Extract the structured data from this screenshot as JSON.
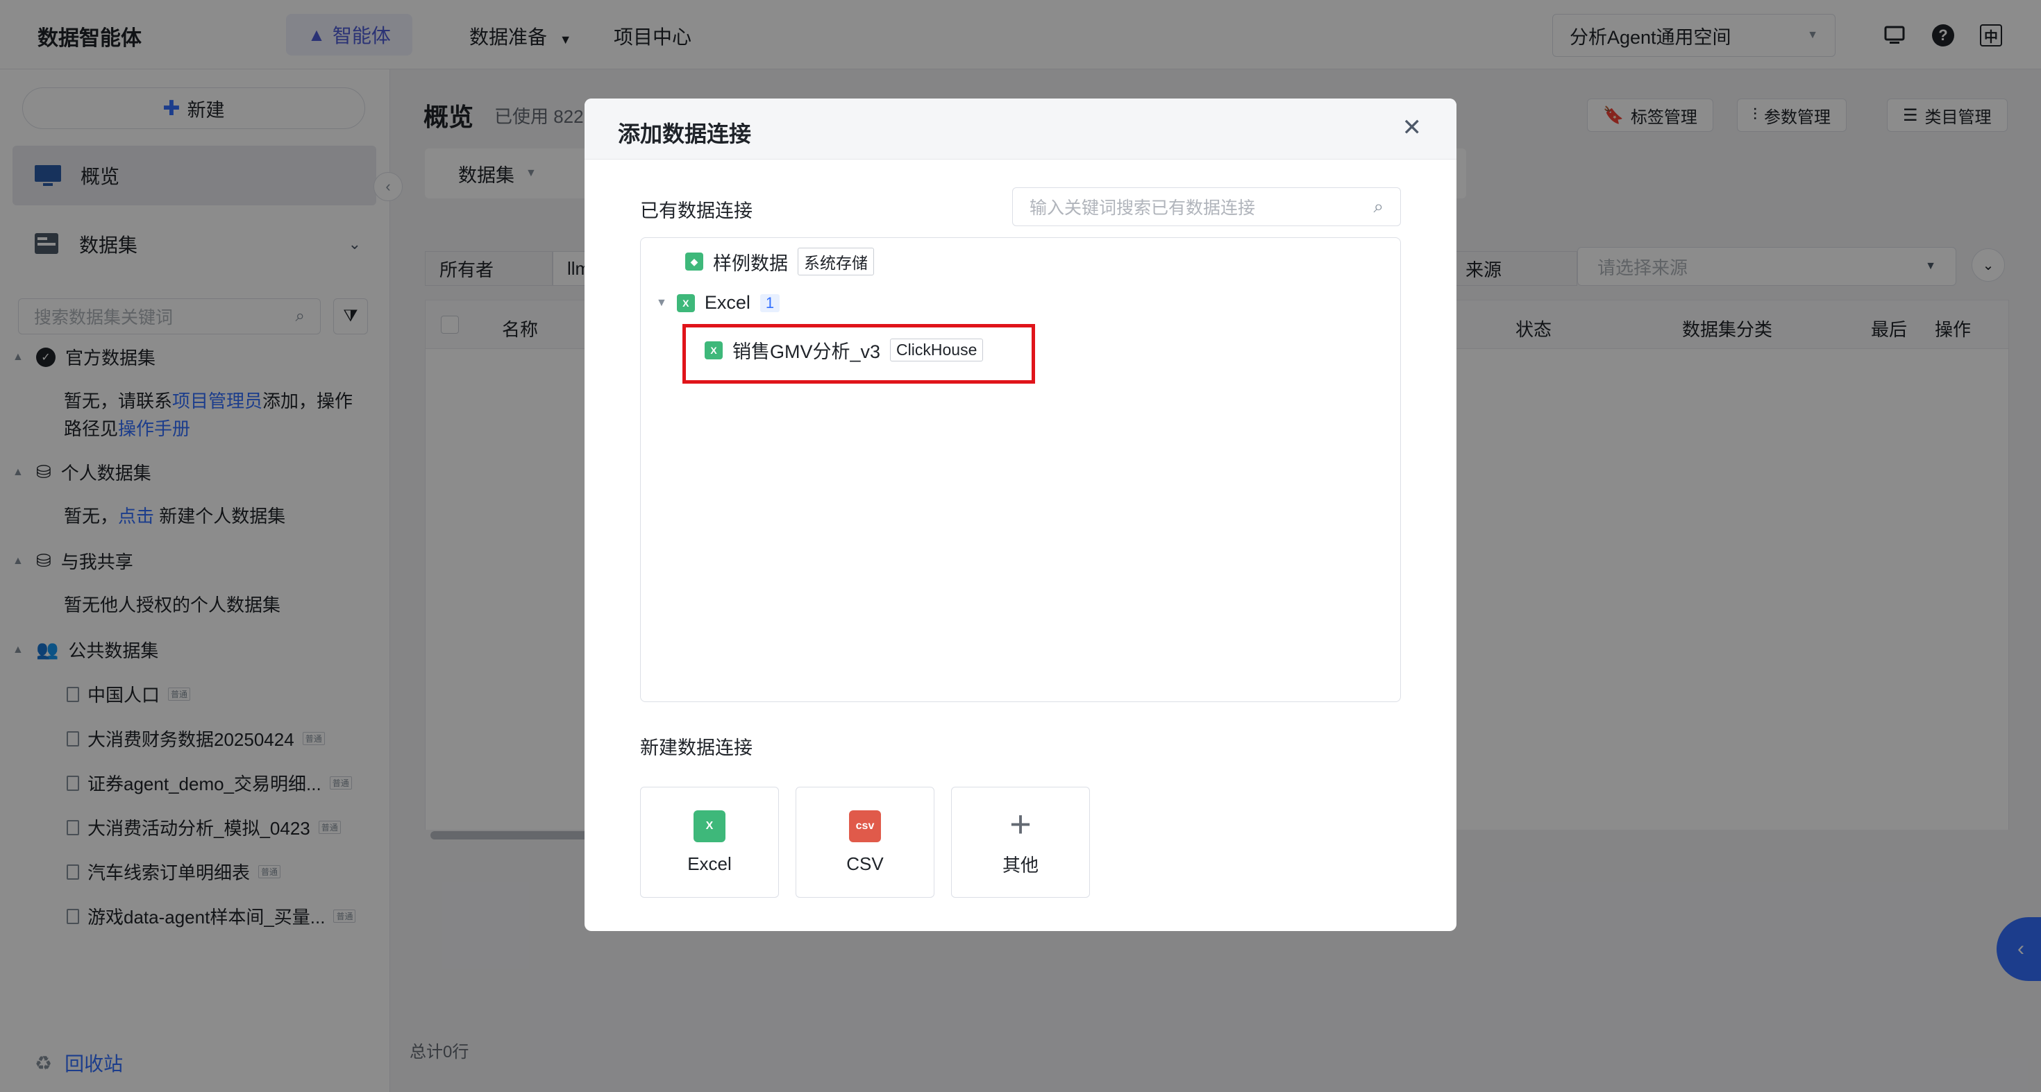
{
  "topbar": {
    "brand": "数据智能体",
    "nav_agent": "智能体",
    "nav_data_prep": "数据准备",
    "nav_projects": "项目中心",
    "space": "分析Agent通用空间",
    "icon_lang": "中"
  },
  "sidebar": {
    "new_label": "新建",
    "overview": "概览",
    "datasets": "数据集",
    "search_placeholder": "搜索数据集关键词",
    "groups": {
      "official": {
        "title": "官方数据集",
        "text1": "暂无，请联系",
        "link1": "项目管理员",
        "text2": "添加，操作",
        "text3": "路径见",
        "link2": "操作手册"
      },
      "personal": {
        "title": "个人数据集",
        "text1": "暂无，",
        "link1": "点击",
        "text2": "新建个人数据集"
      },
      "shared": {
        "title": "与我共享",
        "text1": "暂无他人授权的个人数据集"
      },
      "public": {
        "title": "公共数据集",
        "items": [
          {
            "name": "中国人口",
            "tag": "普通"
          },
          {
            "name": "大消费财务数据20250424",
            "tag": "普通"
          },
          {
            "name": "证券agent_demo_交易明细...",
            "tag": "普通"
          },
          {
            "name": "大消费活动分析_模拟_0423",
            "tag": "普通"
          },
          {
            "name": "汽车线索订单明细表",
            "tag": "普通"
          },
          {
            "name": "游戏data-agent样本间_买量...",
            "tag": "普通"
          }
        ]
      }
    },
    "recycle": "回收站"
  },
  "main": {
    "title": "概览",
    "used": "已使用 822",
    "tab": "数据集",
    "buttons": {
      "tags": "标签管理",
      "params": "参数管理",
      "categories": "类目管理"
    },
    "filter_owner": "所有者",
    "filter_owner_value": "llm",
    "filter_source": "来源",
    "source_placeholder": "请选择来源",
    "columns": {
      "name": "名称",
      "status": "状态",
      "category": "数据集分类",
      "last": "最后",
      "action": "操作"
    },
    "total": "总计0行"
  },
  "modal": {
    "title": "添加数据连接",
    "existing_label": "已有数据连接",
    "search_placeholder": "输入关键词搜索已有数据连接",
    "tree": {
      "sample": {
        "name": "样例数据",
        "tag": "系统存储"
      },
      "excel": {
        "name": "Excel",
        "count": "1"
      },
      "child": {
        "name": "销售GMV分析_v3",
        "tag": "ClickHouse"
      }
    },
    "new_label": "新建数据连接",
    "new_options": {
      "excel": "Excel",
      "csv": "CSV",
      "other": "其他"
    },
    "csv_icon_text": "csv"
  }
}
